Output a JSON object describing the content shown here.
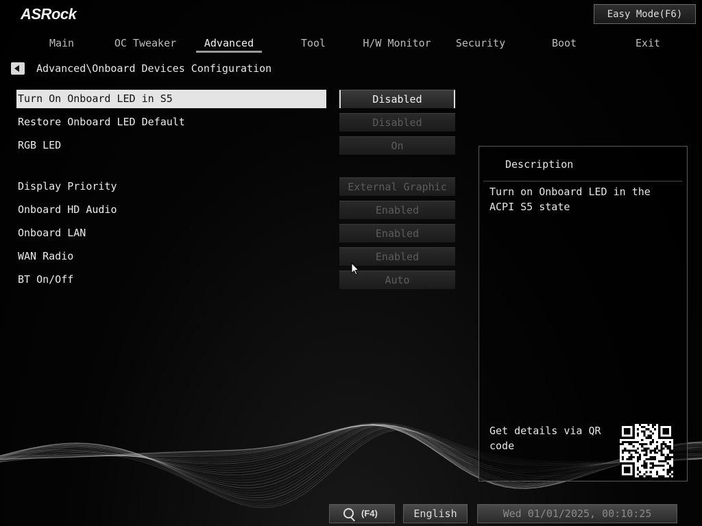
{
  "header": {
    "logo": "ASRock",
    "easy_mode_label": "Easy Mode(F6)"
  },
  "tabs": [
    {
      "label": "Main"
    },
    {
      "label": "OC Tweaker"
    },
    {
      "label": "Advanced"
    },
    {
      "label": "Tool"
    },
    {
      "label": "H/W Monitor"
    },
    {
      "label": "Security"
    },
    {
      "label": "Boot"
    },
    {
      "label": "Exit"
    }
  ],
  "active_tab": "Advanced",
  "breadcrumb": "Advanced\\Onboard Devices Configuration",
  "settings": [
    {
      "label": "Turn On Onboard LED in S5",
      "value": "Disabled",
      "selected": true
    },
    {
      "label": "Restore Onboard LED Default",
      "value": "Disabled"
    },
    {
      "label": "RGB LED",
      "value": "On"
    },
    {
      "label": "Display Priority",
      "value": "External Graphic"
    },
    {
      "label": "Onboard HD Audio",
      "value": "Enabled"
    },
    {
      "label": "Onboard LAN",
      "value": "Enabled"
    },
    {
      "label": "WAN Radio",
      "value": "Enabled"
    },
    {
      "label": "BT On/Off",
      "value": "Auto"
    }
  ],
  "description": {
    "title": "Description",
    "text": "Turn on Onboard LED in the ACPI S5 state",
    "qr_text": "Get details via QR code"
  },
  "footer": {
    "search_key": "(F4)",
    "language": "English",
    "datetime": "Wed 01/01/2025, 00:10:25"
  },
  "colors": {
    "background": "#000000",
    "highlight_row": "#e4e4e4",
    "text": "#e6e6e6",
    "disabled_value": "#5c5c5c"
  }
}
